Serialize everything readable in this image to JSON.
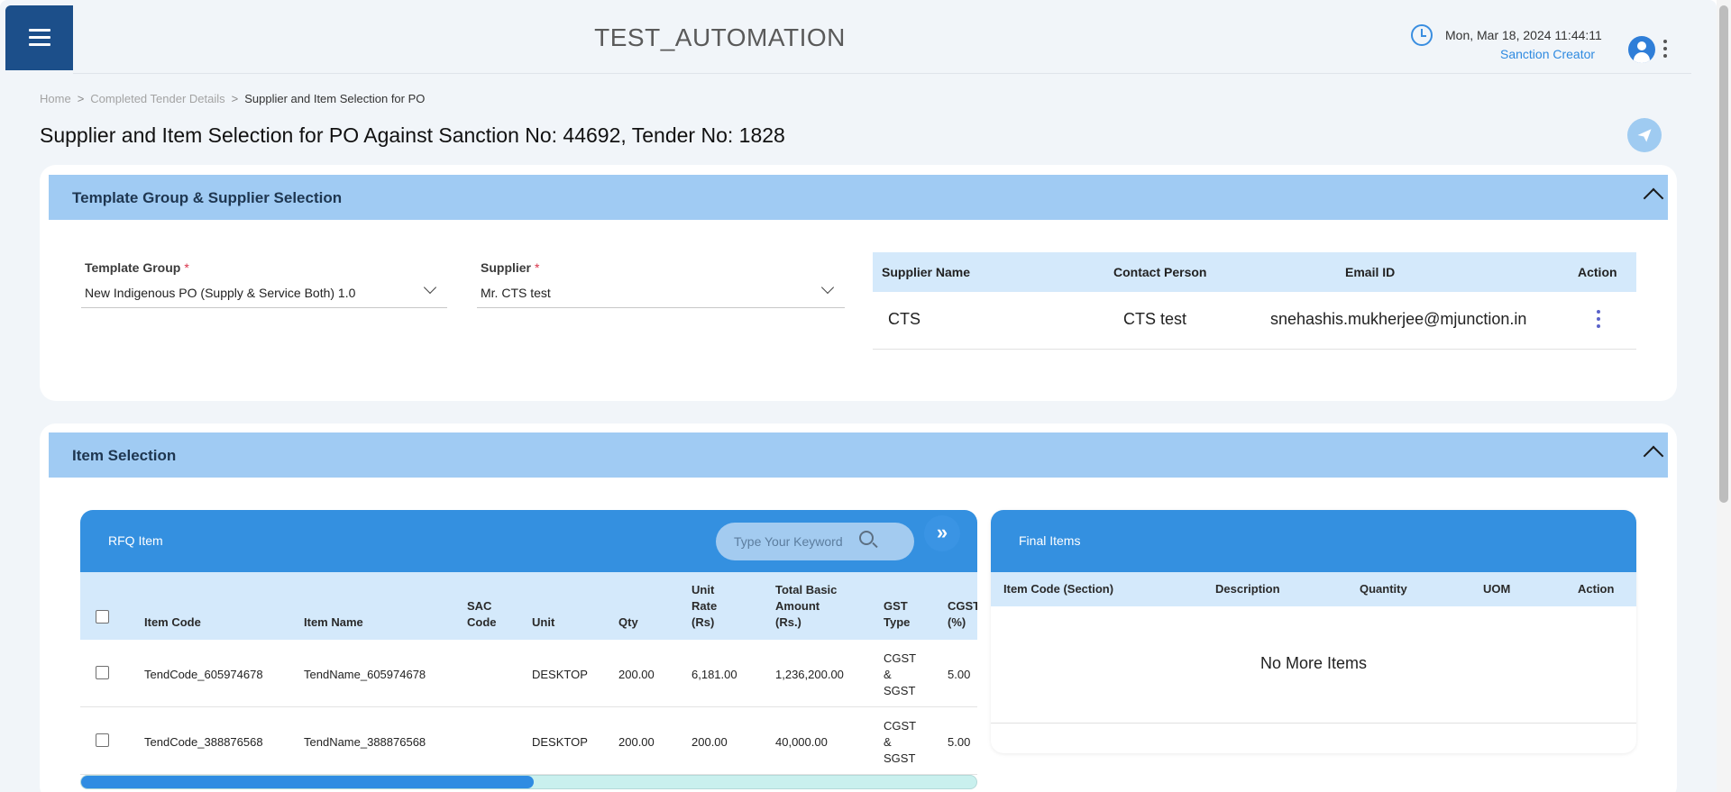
{
  "header": {
    "app_title": "TEST_AUTOMATION",
    "datetime": "Mon, Mar 18, 2024 11:44:11",
    "role": "Sanction Creator"
  },
  "breadcrumb": {
    "items": [
      "Home",
      "Completed Tender Details",
      "Supplier and Item Selection for PO"
    ],
    "separator": ">"
  },
  "page_title": "Supplier and Item Selection for PO Against Sanction No: 44692, Tender No: 1828",
  "template_section": {
    "title": "Template Group & Supplier Selection",
    "template_group": {
      "label": "Template Group",
      "required": "*",
      "value": "New Indigenous PO (Supply & Service Both) 1.0"
    },
    "supplier": {
      "label": "Supplier",
      "required": "*",
      "value": "Mr. CTS test"
    },
    "supplier_table": {
      "columns": [
        "Supplier Name",
        "Contact Person",
        "Email ID",
        "Action"
      ],
      "rows": [
        {
          "supplier_name": "CTS",
          "contact_person": "CTS test",
          "email": "snehashis.mukherjee@mjunction.in"
        }
      ]
    }
  },
  "item_section": {
    "title": "Item Selection",
    "rfq": {
      "title": "RFQ Item",
      "search_placeholder": "Type Your Keyword",
      "expand_icon": "double-chevron-right",
      "columns": {
        "item_code": "Item Code",
        "item_name": "Item Name",
        "sac_code": [
          "SAC",
          "Code"
        ],
        "unit": "Unit",
        "qty": "Qty",
        "unit_rate": [
          "Unit",
          "Rate",
          "(Rs)"
        ],
        "total_basic": [
          "Total Basic",
          "Amount",
          "(Rs.)"
        ],
        "gst_type": [
          "GST",
          "Type"
        ],
        "cgst": [
          "CGST",
          "(%)"
        ]
      },
      "rows": [
        {
          "item_code": "TendCode_605974678",
          "item_name": "TendName_605974678",
          "sac_code": "",
          "unit": "DESKTOP",
          "qty": "200.00",
          "unit_rate": "6,181.00",
          "total_basic": "1,236,200.00",
          "gst_type": [
            "CGST",
            "&",
            "SGST"
          ],
          "cgst": "5.00"
        },
        {
          "item_code": "TendCode_388876568",
          "item_name": "TendName_388876568",
          "sac_code": "",
          "unit": "DESKTOP",
          "qty": "200.00",
          "unit_rate": "200.00",
          "total_basic": "40,000.00",
          "gst_type": [
            "CGST",
            "&",
            "SGST"
          ],
          "cgst": "5.00"
        }
      ],
      "horizontal_scroll_fraction": 0.5
    },
    "final": {
      "title": "Final Items",
      "columns": [
        "Item Code (Section)",
        "Description",
        "Quantity",
        "UOM",
        "Action"
      ],
      "empty_message": "No More Items"
    }
  },
  "colors": {
    "primary_dark": "#1c4f8a",
    "primary": "#3490e0",
    "section_header": "#a0cbf3",
    "table_header": "#d4e9fb",
    "required": "#d9344a"
  }
}
